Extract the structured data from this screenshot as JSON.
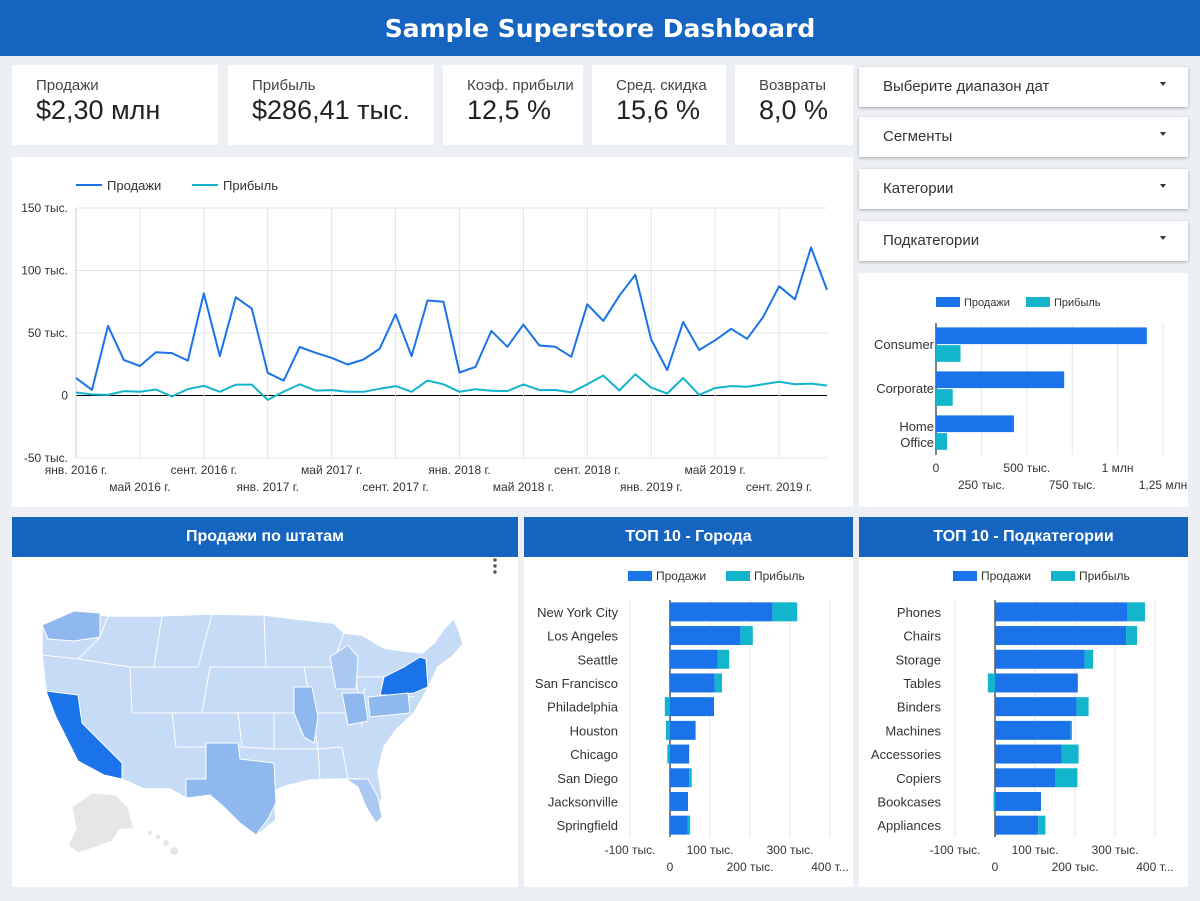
{
  "header": {
    "title": "Sample Superstore Dashboard"
  },
  "kpis": [
    {
      "label": "Продажи",
      "value": "$2,30 млн"
    },
    {
      "label": "Прибыль",
      "value": "$286,41 тыс."
    },
    {
      "label": "Коэф. прибыли",
      "value": "12,5 %"
    },
    {
      "label": "Сред. скидка",
      "value": "15,6 %"
    },
    {
      "label": "Возвраты",
      "value": "8,0 %"
    }
  ],
  "filters": [
    {
      "label": "Выберите диапазон дат"
    },
    {
      "label": "Сегменты"
    },
    {
      "label": "Категории"
    },
    {
      "label": "Подкатегории"
    }
  ],
  "panels": {
    "map_title": "Продажи по штатам",
    "cities_title": "ТОП 10 - Города",
    "subcats_title": "ТОП 10 - Подкатегории"
  },
  "colors": {
    "sales": "#1a73e8",
    "profit": "#12b5cb",
    "header": "#1565c0",
    "map_light": "#c6dbf5",
    "map_mid": "#8fb8ef",
    "map_dark": "#1a73e8"
  },
  "chart_data": [
    {
      "type": "line",
      "legend": [
        "Продажи",
        "Прибыль"
      ],
      "ylim": [
        -50000,
        150000
      ],
      "yticks": [
        "150 тыс.",
        "100 тыс.",
        "50 тыс.",
        "0",
        "-50 тыс."
      ],
      "xticks_top": [
        "янв. 2016 г.",
        "сент. 2016 г.",
        "май 2017 г.",
        "янв. 2018 г.",
        "сент. 2018 г.",
        "май 2019 г."
      ],
      "xticks_bottom": [
        "май 2016 г.",
        "янв. 2017 г.",
        "сент. 2017 г.",
        "май 2018 г.",
        "янв. 2019 г.",
        "сент. 2019 г."
      ],
      "x": [
        "2016-01",
        "2016-02",
        "2016-03",
        "2016-04",
        "2016-05",
        "2016-06",
        "2016-07",
        "2016-08",
        "2016-09",
        "2016-10",
        "2016-11",
        "2016-12",
        "2017-01",
        "2017-02",
        "2017-03",
        "2017-04",
        "2017-05",
        "2017-06",
        "2017-07",
        "2017-08",
        "2017-09",
        "2017-10",
        "2017-11",
        "2017-12",
        "2018-01",
        "2018-02",
        "2018-03",
        "2018-04",
        "2018-05",
        "2018-06",
        "2018-07",
        "2018-08",
        "2018-09",
        "2018-10",
        "2018-11",
        "2018-12",
        "2019-01",
        "2019-02",
        "2019-03",
        "2019-04",
        "2019-05",
        "2019-06",
        "2019-07",
        "2019-08",
        "2019-09",
        "2019-10",
        "2019-11",
        "2019-12"
      ],
      "series": [
        {
          "name": "Продажи",
          "values": [
            14000,
            4500,
            55700,
            28300,
            23600,
            34600,
            33900,
            27900,
            81800,
            31500,
            78600,
            69500,
            18200,
            11900,
            38800,
            34200,
            30100,
            24800,
            28800,
            37400,
            65000,
            31500,
            76000,
            75000,
            18400,
            22900,
            51700,
            39000,
            56700,
            40000,
            39000,
            31000,
            73000,
            59700,
            79800,
            96600,
            44800,
            20300,
            58800,
            36400,
            44200,
            53400,
            45400,
            62700,
            87400,
            77000,
            118400,
            84500
          ]
        },
        {
          "name": "Прибыль",
          "values": [
            2400,
            900,
            500,
            3500,
            3000,
            4800,
            -800,
            5100,
            7800,
            3000,
            8700,
            8700,
            -3500,
            3100,
            9000,
            3900,
            4300,
            3000,
            3000,
            5400,
            7500,
            3000,
            12000,
            9000,
            3000,
            5000,
            3800,
            3500,
            8900,
            4300,
            4400,
            2500,
            9000,
            16000,
            4000,
            17000,
            6300,
            1600,
            14000,
            500,
            6000,
            7500,
            7000,
            9000,
            11000,
            9000,
            9500,
            8000
          ]
        }
      ]
    },
    {
      "type": "bar",
      "orientation": "horizontal",
      "legend": [
        "Продажи",
        "Прибыль"
      ],
      "categories": [
        "Consumer",
        "Corporate",
        "Home Office"
      ],
      "xticks_top": [
        "0",
        "500 тыс.",
        "1 млн"
      ],
      "xticks_bottom": [
        "250 тыс.",
        "750 тыс.",
        "1,25 млн"
      ],
      "xlim": [
        0,
        1250000
      ],
      "series": [
        {
          "name": "Продажи",
          "values": [
            1161000,
            706000,
            429000
          ]
        },
        {
          "name": "Прибыль",
          "values": [
            135000,
            92000,
            61000
          ]
        }
      ]
    },
    {
      "type": "bar",
      "orientation": "horizontal",
      "title": "ТОП 10 - Города",
      "legend": [
        "Продажи",
        "Прибыль"
      ],
      "categories": [
        "New York City",
        "Los Angeles",
        "Seattle",
        "San Francisco",
        "Philadelphia",
        "Houston",
        "Chicago",
        "San Diego",
        "Jacksonville",
        "Springfield"
      ],
      "xticks_top": [
        "-100 тыс.",
        "100 тыс.",
        "300 тыс."
      ],
      "xticks_bottom": [
        "0",
        "200 тыс.",
        "400 т..."
      ],
      "xlim": [
        -100000,
        400000
      ],
      "series": [
        {
          "name": "Продажи",
          "values": [
            256000,
            176000,
            119000,
            112000,
            110000,
            64000,
            48000,
            48000,
            45000,
            44000
          ]
        },
        {
          "name": "Прибыль",
          "values": [
            62000,
            31000,
            29000,
            18000,
            -13000,
            -10000,
            -6700,
            6400,
            -2300,
            6300
          ]
        }
      ]
    },
    {
      "type": "bar",
      "orientation": "horizontal",
      "title": "ТОП 10 - Подкатегории",
      "legend": [
        "Продажи",
        "Прибыль"
      ],
      "categories": [
        "Phones",
        "Chairs",
        "Storage",
        "Tables",
        "Binders",
        "Machines",
        "Accessories",
        "Copiers",
        "Bookcases",
        "Appliances"
      ],
      "xticks_top": [
        "-100 тыс.",
        "100 тыс.",
        "300 тыс."
      ],
      "xticks_bottom": [
        "0",
        "200 тыс.",
        "400 т..."
      ],
      "xlim": [
        -100000,
        400000
      ],
      "series": [
        {
          "name": "Продажи",
          "values": [
            330000,
            328000,
            224000,
            207000,
            204000,
            189000,
            167000,
            150000,
            115000,
            108000
          ]
        },
        {
          "name": "Прибыль",
          "values": [
            45000,
            27000,
            21000,
            -18000,
            30000,
            3400,
            42000,
            56000,
            -3500,
            18000
          ]
        }
      ]
    }
  ]
}
